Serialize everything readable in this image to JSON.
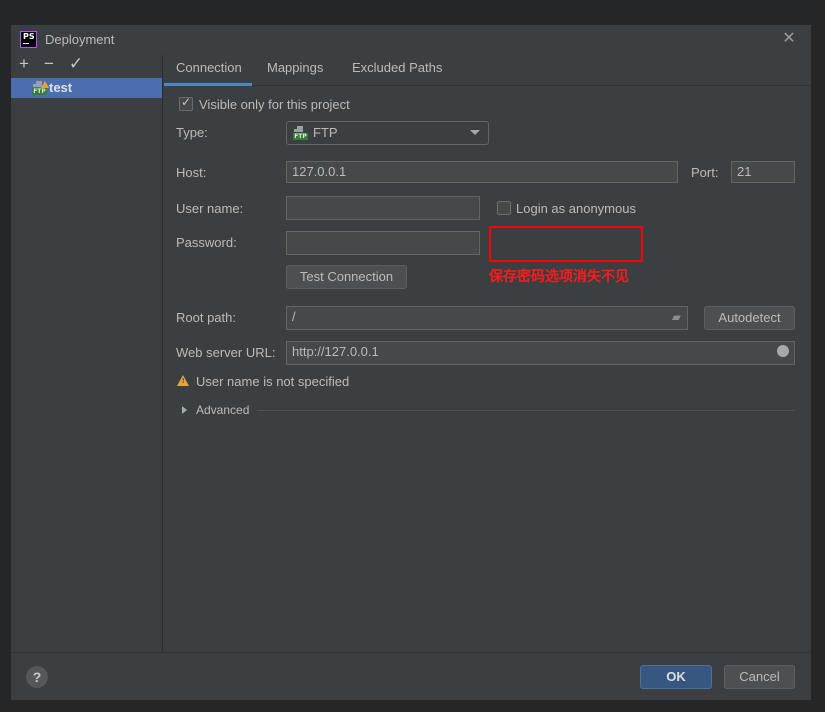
{
  "window": {
    "title": "Deployment",
    "app_icon": "phpstorm-logo",
    "app_icon_text": "PS",
    "close_icon": "close-icon"
  },
  "left_panel": {
    "toolbar": [
      {
        "name": "add",
        "glyph": "+"
      },
      {
        "name": "remove",
        "glyph": "−"
      },
      {
        "name": "set-default",
        "glyph": "✓"
      }
    ],
    "servers": [
      {
        "label": "test",
        "icon": "ftp-icon",
        "badge": "warning",
        "selected": true
      }
    ]
  },
  "tabs": [
    {
      "label": "Connection",
      "active": true
    },
    {
      "label": "Mappings",
      "active": false
    },
    {
      "label": "Excluded Paths",
      "active": false
    }
  ],
  "connection": {
    "visible_only": {
      "label": "Visible only for this project",
      "checked": true
    },
    "type": {
      "label": "Type:",
      "value": "FTP",
      "icon_text": "FTP"
    },
    "host": {
      "label": "Host:",
      "value": "127.0.0.1"
    },
    "port": {
      "label": "Port:",
      "value": "21"
    },
    "username": {
      "label": "User name:",
      "value": ""
    },
    "login_anonymous": {
      "label": "Login as anonymous",
      "checked": false
    },
    "password": {
      "label": "Password:",
      "value": ""
    },
    "test_connection": "Test Connection",
    "root_path": {
      "label": "Root path:",
      "value": "/"
    },
    "autodetect": "Autodetect",
    "web_server_url": {
      "label": "Web server URL:",
      "value": "http://127.0.0.1"
    },
    "warning": "User name is not specified",
    "advanced": "Advanced"
  },
  "annotation": {
    "text": "保存密码选项消失不见",
    "color": "#ff0000"
  },
  "footer": {
    "help": "?",
    "ok": "OK",
    "cancel": "Cancel"
  },
  "colors": {
    "background": "#3c3f41",
    "selection": "#4b6eaf",
    "tab_underline": "#4a88c7",
    "ok_button": "#365880",
    "warning": "#e8a33d"
  }
}
